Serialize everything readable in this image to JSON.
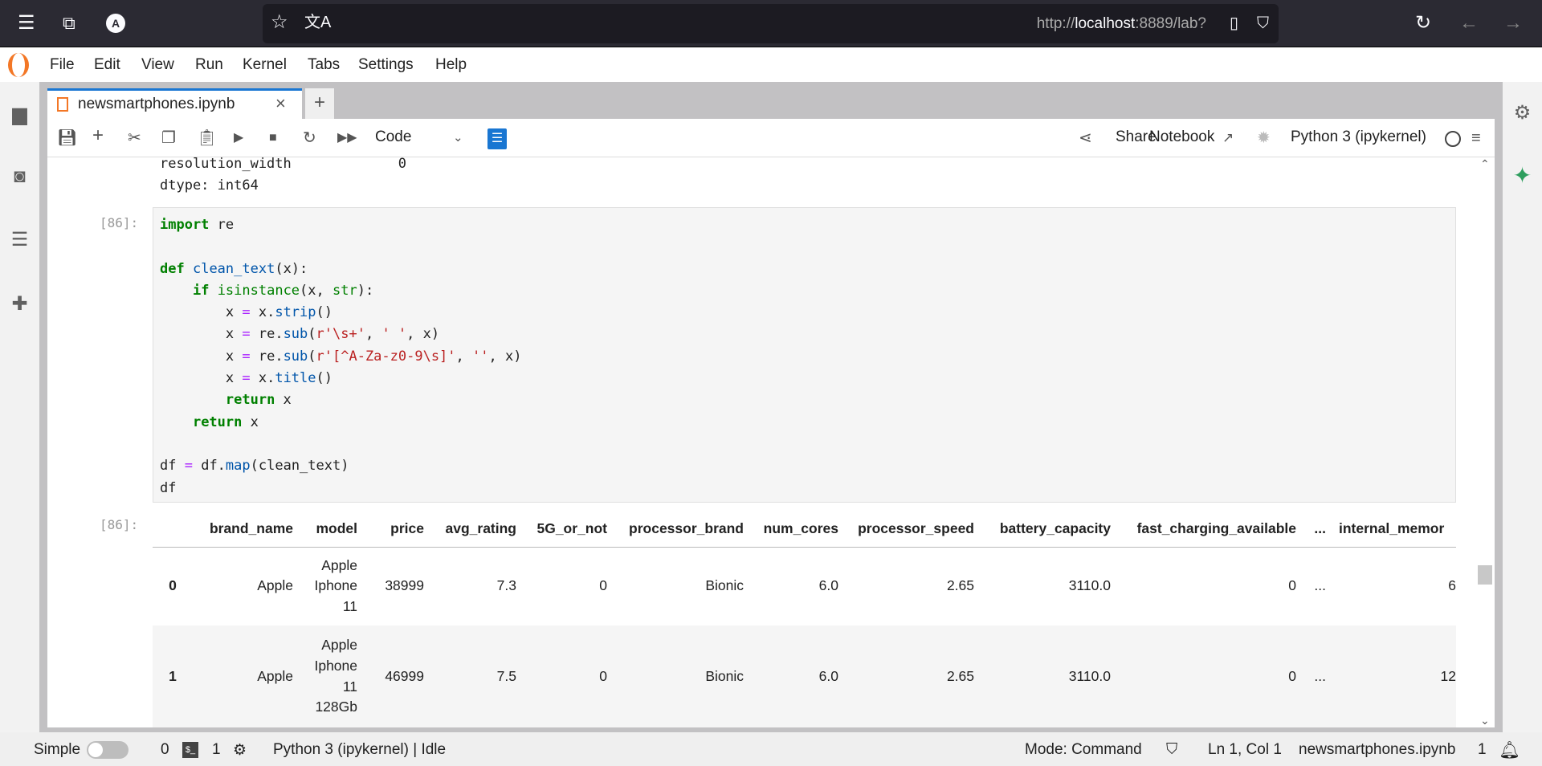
{
  "browser": {
    "url_prefix": "http://",
    "url_host": "localhost",
    "url_rest": ":8889/lab?",
    "icons": [
      "menu-icon",
      "extension-icon",
      "account-icon",
      "star-icon",
      "translate-icon",
      "page-icon",
      "shield-icon",
      "reload-icon",
      "back-icon",
      "forward-icon"
    ]
  },
  "menu": [
    "File",
    "Edit",
    "View",
    "Run",
    "Kernel",
    "Tabs",
    "Settings",
    "Help"
  ],
  "tab": {
    "title": "newsmartphones.ipynb",
    "close": "×",
    "add": "+"
  },
  "toolbar": {
    "cell_type": "Code",
    "share": "Share",
    "notebook": "Notebook",
    "kernel": "Python 3 (ipykernel)",
    "accent": "#1976d2"
  },
  "output_prev": {
    "line1": "resolution_width             0",
    "line2": "dtype: int64"
  },
  "cell": {
    "prompt": "[86]:",
    "out_prompt": "[86]:"
  },
  "table": {
    "columns": [
      "",
      "brand_name",
      "model",
      "price",
      "avg_rating",
      "5G_or_not",
      "processor_brand",
      "num_cores",
      "processor_speed",
      "battery_capacity",
      "fast_charging_available",
      "...",
      "internal_memor"
    ],
    "rows": [
      {
        "idx": "0",
        "brand_name": "Apple",
        "model": "Apple Iphone 11",
        "price": "38999",
        "avg_rating": "7.3",
        "fiveg": "0",
        "processor_brand": "Bionic",
        "num_cores": "6.0",
        "processor_speed": "2.65",
        "battery_capacity": "3110.0",
        "fast_charging": "0",
        "ellipsis": "...",
        "internal_memory": "6"
      },
      {
        "idx": "1",
        "brand_name": "Apple",
        "model": "Apple Iphone 11 128Gb",
        "price": "46999",
        "avg_rating": "7.5",
        "fiveg": "0",
        "processor_brand": "Bionic",
        "num_cores": "6.0",
        "processor_speed": "2.65",
        "battery_capacity": "3110.0",
        "fast_charging": "0",
        "ellipsis": "...",
        "internal_memory": "12"
      }
    ]
  },
  "status": {
    "mode_label": "Simple",
    "terminals": "0",
    "kernels": "1",
    "kernel_status": "Python 3 (ipykernel) | Idle",
    "mode": "Mode: Command",
    "position": "Ln 1, Col 1",
    "file": "newsmartphones.ipynb",
    "notifications": "1"
  }
}
